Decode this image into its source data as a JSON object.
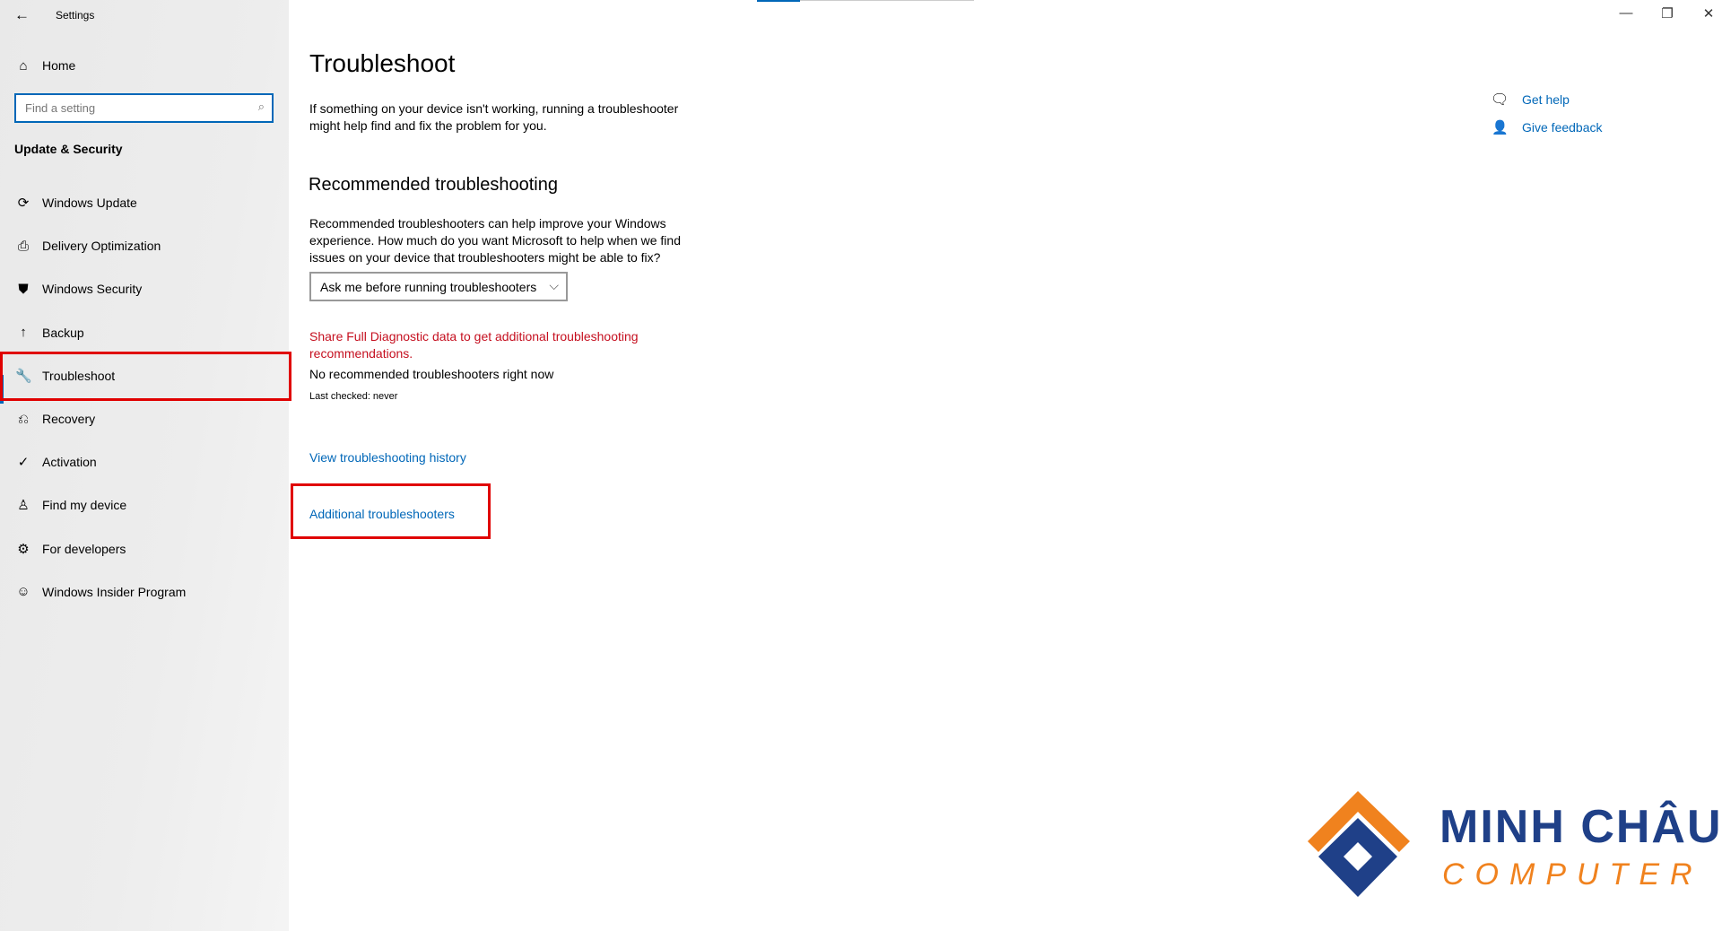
{
  "window": {
    "title": "Settings",
    "controls": {
      "minimize": "—",
      "restore": "❐",
      "close": "✕"
    }
  },
  "sidebar": {
    "home": "Home",
    "search_placeholder": "Find a setting",
    "section": "Update & Security",
    "items": [
      {
        "label": "Windows Update",
        "icon": "sync-icon"
      },
      {
        "label": "Delivery Optimization",
        "icon": "delivery-icon"
      },
      {
        "label": "Windows Security",
        "icon": "shield-icon"
      },
      {
        "label": "Backup",
        "icon": "backup-arrow-icon"
      },
      {
        "label": "Troubleshoot",
        "icon": "wrench-icon",
        "selected": true
      },
      {
        "label": "Recovery",
        "icon": "recovery-icon"
      },
      {
        "label": "Activation",
        "icon": "check-circle-icon"
      },
      {
        "label": "Find my device",
        "icon": "person-pin-icon"
      },
      {
        "label": "For developers",
        "icon": "developer-icon"
      },
      {
        "label": "Windows Insider Program",
        "icon": "insider-icon"
      }
    ]
  },
  "main": {
    "title": "Troubleshoot",
    "intro": "If something on your device isn't working, running a troubleshooter might help find and fix the problem for you.",
    "rec_heading": "Recommended troubleshooting",
    "rec_desc": "Recommended troubleshooters can help improve your Windows experience. How much do you want Microsoft to help when we find issues on your device that troubleshooters might be able to fix?",
    "dropdown_value": "Ask me before running troubleshooters",
    "diagnostic_warning": "Share Full Diagnostic data to get additional troubleshooting recommendations.",
    "no_recommended": "No recommended troubleshooters right now",
    "last_checked": "Last checked: never",
    "history_link": "View troubleshooting history",
    "additional_link": "Additional troubleshooters"
  },
  "help": {
    "get_help": "Get help",
    "give_feedback": "Give feedback"
  },
  "logo": {
    "line1": "MINH CHÂU",
    "line2": "COMPUTER"
  },
  "colors": {
    "accent": "#0067b8",
    "warning": "#c50f1f",
    "highlight": "#e00000",
    "logo_blue": "#1f4088",
    "logo_orange": "#f0821e"
  }
}
